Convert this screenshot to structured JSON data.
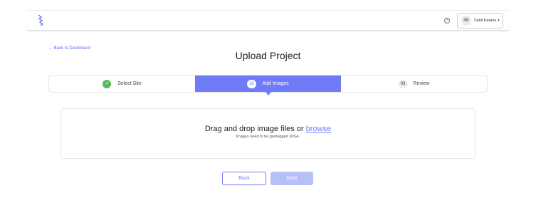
{
  "header": {
    "logo_icon": "bird-logo-icon",
    "help_icon": "help-circle-icon",
    "help_glyph": "?",
    "user": {
      "initials": "SK",
      "name": "Sahil Kataria",
      "caret": "▾"
    }
  },
  "nav": {
    "back_label": "← Back to Dashboard"
  },
  "page": {
    "title": "Upload Project"
  },
  "stepper": {
    "steps": [
      {
        "badge": "✓",
        "label": "Select Site",
        "state": "complete"
      },
      {
        "badge": "02",
        "label": "Add Images",
        "state": "active"
      },
      {
        "badge": "03",
        "label": "Review",
        "state": "upcoming"
      }
    ]
  },
  "dropzone": {
    "text": "Drag and drop image files or",
    "browse_label": "browse",
    "hint": "Images need to be geotagged JPGs."
  },
  "actions": {
    "back_label": "Back",
    "next_label": "Next"
  },
  "colors": {
    "accent": "#6f7bf7",
    "success": "#5cb85c",
    "disabled": "#b7bff8"
  }
}
